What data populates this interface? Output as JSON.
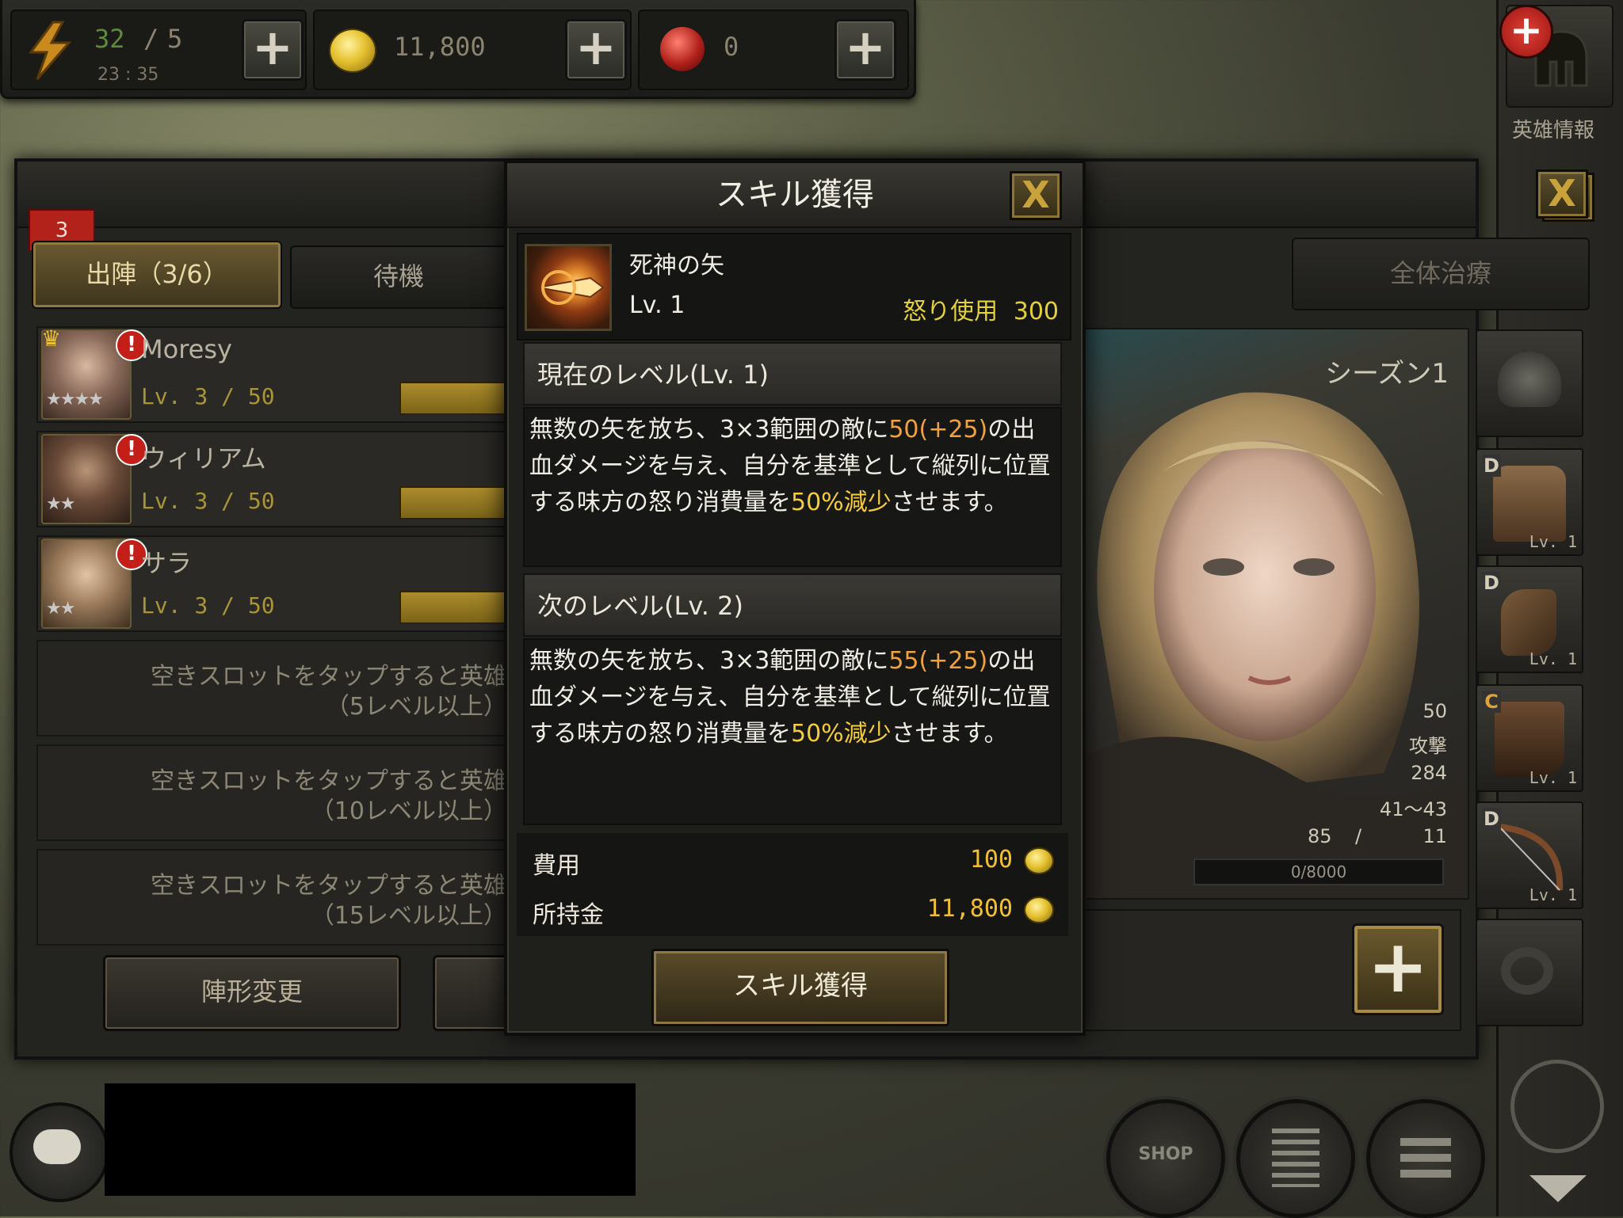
{
  "topbar": {
    "energy_value": "32",
    "energy_sep": "/",
    "energy_max": "5",
    "energy_timer": "23 : 35",
    "gold": "11,800",
    "gems": "0"
  },
  "right_column": {
    "hero_info_label": "英雄情報",
    "badge": "+"
  },
  "main_window": {
    "tab_badge": "3",
    "tab_active_label": "出陣（3/6）",
    "tab_inactive_label": "待機",
    "heroes": [
      {
        "name": "Moresy",
        "level": "Lv.  3 / 50",
        "stars": "★★★★"
      },
      {
        "name": "ウィリアム",
        "level": "Lv.  3 / 50",
        "stars": "★★"
      },
      {
        "name": "サラ",
        "level": "Lv.  3 / 50",
        "stars": "★★"
      }
    ],
    "empty_slots": [
      {
        "line1": "空きスロットをタップすると英雄",
        "line2": "（5レベル以上）"
      },
      {
        "line1": "空きスロットをタップすると英雄",
        "line2": "（10レベル以上）"
      },
      {
        "line1": "空きスロットをタップすると英雄",
        "line2": "（15レベル以上）"
      }
    ],
    "formation_button": "陣形変更",
    "heal_all_button": "全体治療",
    "season_label": "シーズン1",
    "stats": {
      "level": "50",
      "attack_label": "攻撃",
      "power": "284",
      "damage_range": "41～43",
      "stat_a": "85",
      "stat_sep": "/",
      "stat_b": "11",
      "exp": "0/8000"
    },
    "equipment": [
      {
        "grade": "",
        "level": ""
      },
      {
        "grade": "D",
        "level": "Lv. 1"
      },
      {
        "grade": "D",
        "level": "Lv. 1"
      },
      {
        "grade": "C",
        "level": "Lv. 1"
      },
      {
        "grade": "D",
        "level": "Lv. 1"
      },
      {
        "grade": "",
        "level": ""
      }
    ]
  },
  "modal": {
    "title": "スキル獲得",
    "close_label": "X",
    "skill_name": "死神の矢",
    "skill_level": "Lv. 1",
    "rage_label": "怒り使用",
    "rage_value": "300",
    "current_header": "現在のレベル(Lv. 1)",
    "current_desc": {
      "p1": "無数の矢を放ち、3×3範囲の敵に",
      "dmg": "50(+25)",
      "p2": "の出血ダメージを与え、自分を基準として縦列に位置する味方の怒り消費量を",
      "reduce": "50%減少",
      "p3": "させます。"
    },
    "next_header": "次のレベル(Lv. 2)",
    "next_desc": {
      "p1": "無数の矢を放ち、3×3範囲の敵に",
      "dmg": "55(+25)",
      "p2": "の出血ダメージを与え、自分を基準として縦列に位置する味方の怒り消費量を",
      "reduce": "50%減少",
      "p3": "させます。"
    },
    "cost_label": "費用",
    "cost_value": "100",
    "owned_label": "所持金",
    "owned_value": "11,800",
    "acquire_button": "スキル獲得"
  },
  "bottom": {
    "shop_label": "SHOP"
  }
}
